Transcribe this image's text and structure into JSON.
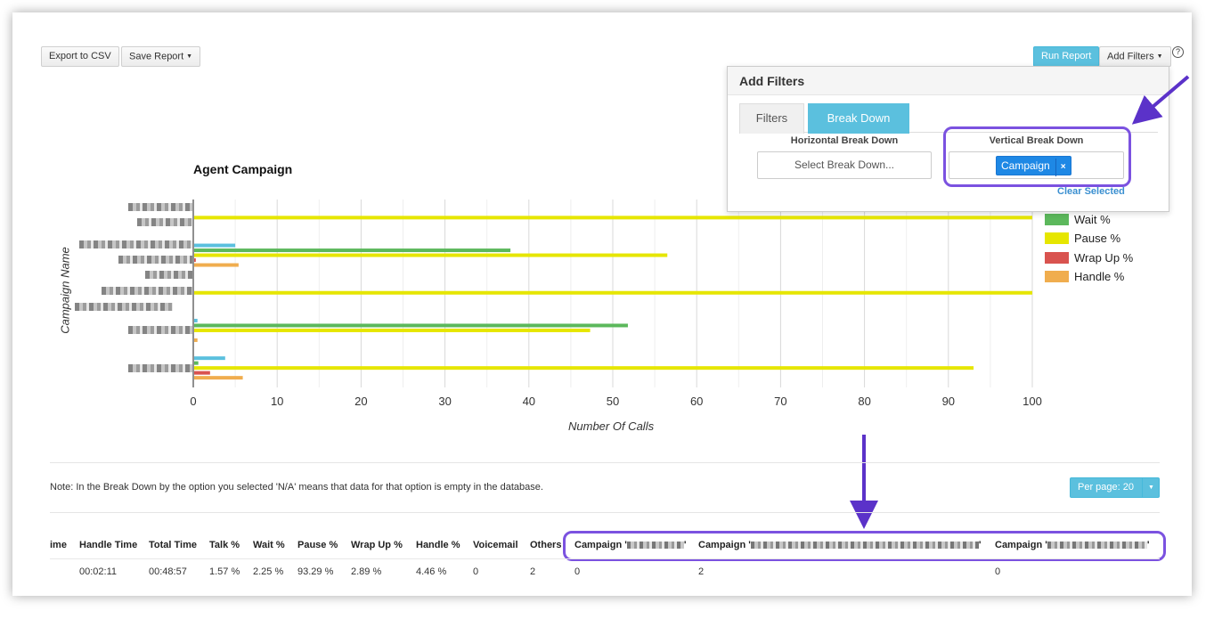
{
  "toolbar": {
    "export_label": "Export to CSV",
    "save_report_label": "Save Report",
    "run_report_label": "Run Report",
    "add_filters_label": "Add Filters",
    "help_label": "?"
  },
  "filters_panel": {
    "title": "Add Filters",
    "tabs": [
      {
        "label": "Filters",
        "active": false
      },
      {
        "label": "Break Down",
        "active": true
      }
    ],
    "horizontal_label": "Horizontal Break Down",
    "horizontal_placeholder": "Select Break Down...",
    "vertical_label": "Vertical Break Down",
    "vertical_selected": "Campaign",
    "remove_label": "×",
    "clear_label": "Clear Selected"
  },
  "chart_data": {
    "type": "bar",
    "orientation": "horizontal",
    "title": "Agent Campaign",
    "xlabel": "Number Of Calls",
    "ylabel": "Campaign Name",
    "xlim": [
      0,
      100
    ],
    "xticks": [
      "0",
      "10",
      "20",
      "30",
      "40",
      "50",
      "60",
      "70",
      "80",
      "90",
      "100"
    ],
    "grid": true,
    "series": [
      {
        "name": "Talk %",
        "color": "#5bc0de",
        "values": [
          0,
          5,
          0,
          0.5,
          3.8
        ]
      },
      {
        "name": "Wait %",
        "color": "#5cb85c",
        "values": [
          0,
          37.8,
          0,
          51.8,
          0.6
        ]
      },
      {
        "name": "Pause %",
        "color": "#e6e600",
        "values": [
          100,
          56.5,
          100,
          47.3,
          93
        ]
      },
      {
        "name": "Wrap Up %",
        "color": "#d9534f",
        "values": [
          0,
          0.3,
          0,
          0,
          2
        ]
      },
      {
        "name": "Handle %",
        "color": "#f0ad4e",
        "values": [
          0,
          5.4,
          0,
          0.5,
          5.9
        ]
      }
    ],
    "legend_visible": [
      "Wait %",
      "Pause %",
      "Wrap Up %",
      "Handle %"
    ],
    "legend_position": "right"
  },
  "note": "Note: In the Break Down by the option you selected 'N/A' means that data for that option is empty in the database.",
  "per_page_label": "Per page: 20",
  "table": {
    "headers": [
      "ime",
      "Handle Time",
      "Total Time",
      "Talk %",
      "Wait %",
      "Pause %",
      "Wrap Up %",
      "Handle %",
      "Voicemail",
      "Others"
    ],
    "campaign_prefix": "Campaign '",
    "campaign_suffix": "'",
    "row": [
      "",
      "00:02:11",
      "00:48:57",
      "1.57 %",
      "2.25 %",
      "93.29 %",
      "2.89 %",
      "4.46 %",
      "0",
      "2",
      "0",
      "2",
      "0"
    ]
  }
}
